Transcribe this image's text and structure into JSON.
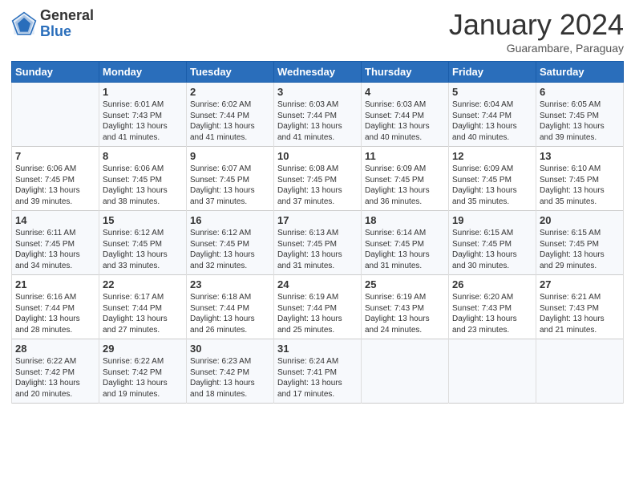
{
  "header": {
    "logo_general": "General",
    "logo_blue": "Blue",
    "month_title": "January 2024",
    "location": "Guarambare, Paraguay"
  },
  "days_of_week": [
    "Sunday",
    "Monday",
    "Tuesday",
    "Wednesday",
    "Thursday",
    "Friday",
    "Saturday"
  ],
  "weeks": [
    [
      {
        "day": "",
        "info": ""
      },
      {
        "day": "1",
        "info": "Sunrise: 6:01 AM\nSunset: 7:43 PM\nDaylight: 13 hours\nand 41 minutes."
      },
      {
        "day": "2",
        "info": "Sunrise: 6:02 AM\nSunset: 7:44 PM\nDaylight: 13 hours\nand 41 minutes."
      },
      {
        "day": "3",
        "info": "Sunrise: 6:03 AM\nSunset: 7:44 PM\nDaylight: 13 hours\nand 41 minutes."
      },
      {
        "day": "4",
        "info": "Sunrise: 6:03 AM\nSunset: 7:44 PM\nDaylight: 13 hours\nand 40 minutes."
      },
      {
        "day": "5",
        "info": "Sunrise: 6:04 AM\nSunset: 7:44 PM\nDaylight: 13 hours\nand 40 minutes."
      },
      {
        "day": "6",
        "info": "Sunrise: 6:05 AM\nSunset: 7:45 PM\nDaylight: 13 hours\nand 39 minutes."
      }
    ],
    [
      {
        "day": "7",
        "info": "Sunrise: 6:06 AM\nSunset: 7:45 PM\nDaylight: 13 hours\nand 39 minutes."
      },
      {
        "day": "8",
        "info": "Sunrise: 6:06 AM\nSunset: 7:45 PM\nDaylight: 13 hours\nand 38 minutes."
      },
      {
        "day": "9",
        "info": "Sunrise: 6:07 AM\nSunset: 7:45 PM\nDaylight: 13 hours\nand 37 minutes."
      },
      {
        "day": "10",
        "info": "Sunrise: 6:08 AM\nSunset: 7:45 PM\nDaylight: 13 hours\nand 37 minutes."
      },
      {
        "day": "11",
        "info": "Sunrise: 6:09 AM\nSunset: 7:45 PM\nDaylight: 13 hours\nand 36 minutes."
      },
      {
        "day": "12",
        "info": "Sunrise: 6:09 AM\nSunset: 7:45 PM\nDaylight: 13 hours\nand 35 minutes."
      },
      {
        "day": "13",
        "info": "Sunrise: 6:10 AM\nSunset: 7:45 PM\nDaylight: 13 hours\nand 35 minutes."
      }
    ],
    [
      {
        "day": "14",
        "info": "Sunrise: 6:11 AM\nSunset: 7:45 PM\nDaylight: 13 hours\nand 34 minutes."
      },
      {
        "day": "15",
        "info": "Sunrise: 6:12 AM\nSunset: 7:45 PM\nDaylight: 13 hours\nand 33 minutes."
      },
      {
        "day": "16",
        "info": "Sunrise: 6:12 AM\nSunset: 7:45 PM\nDaylight: 13 hours\nand 32 minutes."
      },
      {
        "day": "17",
        "info": "Sunrise: 6:13 AM\nSunset: 7:45 PM\nDaylight: 13 hours\nand 31 minutes."
      },
      {
        "day": "18",
        "info": "Sunrise: 6:14 AM\nSunset: 7:45 PM\nDaylight: 13 hours\nand 31 minutes."
      },
      {
        "day": "19",
        "info": "Sunrise: 6:15 AM\nSunset: 7:45 PM\nDaylight: 13 hours\nand 30 minutes."
      },
      {
        "day": "20",
        "info": "Sunrise: 6:15 AM\nSunset: 7:45 PM\nDaylight: 13 hours\nand 29 minutes."
      }
    ],
    [
      {
        "day": "21",
        "info": "Sunrise: 6:16 AM\nSunset: 7:44 PM\nDaylight: 13 hours\nand 28 minutes."
      },
      {
        "day": "22",
        "info": "Sunrise: 6:17 AM\nSunset: 7:44 PM\nDaylight: 13 hours\nand 27 minutes."
      },
      {
        "day": "23",
        "info": "Sunrise: 6:18 AM\nSunset: 7:44 PM\nDaylight: 13 hours\nand 26 minutes."
      },
      {
        "day": "24",
        "info": "Sunrise: 6:19 AM\nSunset: 7:44 PM\nDaylight: 13 hours\nand 25 minutes."
      },
      {
        "day": "25",
        "info": "Sunrise: 6:19 AM\nSunset: 7:43 PM\nDaylight: 13 hours\nand 24 minutes."
      },
      {
        "day": "26",
        "info": "Sunrise: 6:20 AM\nSunset: 7:43 PM\nDaylight: 13 hours\nand 23 minutes."
      },
      {
        "day": "27",
        "info": "Sunrise: 6:21 AM\nSunset: 7:43 PM\nDaylight: 13 hours\nand 21 minutes."
      }
    ],
    [
      {
        "day": "28",
        "info": "Sunrise: 6:22 AM\nSunset: 7:42 PM\nDaylight: 13 hours\nand 20 minutes."
      },
      {
        "day": "29",
        "info": "Sunrise: 6:22 AM\nSunset: 7:42 PM\nDaylight: 13 hours\nand 19 minutes."
      },
      {
        "day": "30",
        "info": "Sunrise: 6:23 AM\nSunset: 7:42 PM\nDaylight: 13 hours\nand 18 minutes."
      },
      {
        "day": "31",
        "info": "Sunrise: 6:24 AM\nSunset: 7:41 PM\nDaylight: 13 hours\nand 17 minutes."
      },
      {
        "day": "",
        "info": ""
      },
      {
        "day": "",
        "info": ""
      },
      {
        "day": "",
        "info": ""
      }
    ]
  ]
}
